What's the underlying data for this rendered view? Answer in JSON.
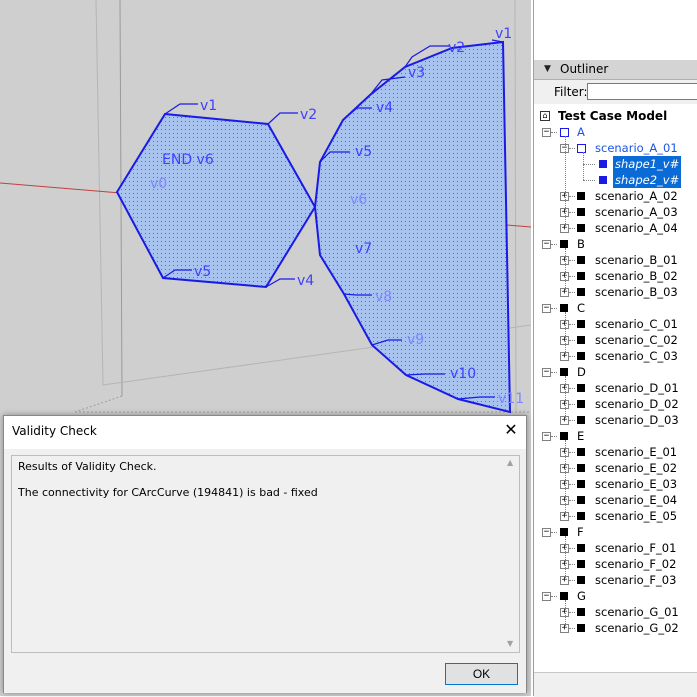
{
  "viewport": {
    "hexagon_labels": {
      "v1": "v1",
      "v2": "v2",
      "v4": "v4",
      "v5": "v5",
      "end_v6": "END v6",
      "v0": "v0"
    },
    "fan_labels": {
      "v1": "v1",
      "v2": "v2",
      "v3": "v3",
      "v4": "v4",
      "v5": "v5",
      "v6": "v6",
      "v7": "v7",
      "v8": "v8",
      "v9": "v9",
      "v10": "v10",
      "v11": "v11"
    },
    "colors": {
      "background": "#cfcfcf",
      "shape_fill": "#a7c1ef",
      "shape_stroke": "#1a1ae6",
      "label": "#4040ff",
      "axis_line": "#c04040"
    }
  },
  "outliner": {
    "title": "Outliner",
    "filter_label": "Filter:",
    "filter_value": "",
    "root": "Test Case Model",
    "tree": [
      {
        "label": "A",
        "expander": "−",
        "children": [
          {
            "label": "scenario_A_01",
            "expander": "−",
            "children": [
              {
                "label": "shape1_v#",
                "selected": true
              },
              {
                "label": "shape2_v#",
                "selected": true
              }
            ]
          },
          {
            "label": "scenario_A_02",
            "expander": "+"
          },
          {
            "label": "scenario_A_03",
            "expander": "+"
          },
          {
            "label": "scenario_A_04",
            "expander": "+"
          }
        ]
      },
      {
        "label": "B",
        "expander": "−",
        "children": [
          {
            "label": "scenario_B_01",
            "expander": "+"
          },
          {
            "label": "scenario_B_02",
            "expander": "+"
          },
          {
            "label": "scenario_B_03",
            "expander": "+"
          }
        ]
      },
      {
        "label": "C",
        "expander": "−",
        "children": [
          {
            "label": "scenario_C_01",
            "expander": "+"
          },
          {
            "label": "scenario_C_02",
            "expander": "+"
          },
          {
            "label": "scenario_C_03",
            "expander": "+"
          }
        ]
      },
      {
        "label": "D",
        "expander": "−",
        "children": [
          {
            "label": "scenario_D_01",
            "expander": "+"
          },
          {
            "label": "scenario_D_02",
            "expander": "+"
          },
          {
            "label": "scenario_D_03",
            "expander": "+"
          }
        ]
      },
      {
        "label": "E",
        "expander": "−",
        "children": [
          {
            "label": "scenario_E_01",
            "expander": "+"
          },
          {
            "label": "scenario_E_02",
            "expander": "+"
          },
          {
            "label": "scenario_E_03",
            "expander": "+"
          },
          {
            "label": "scenario_E_04",
            "expander": "+"
          },
          {
            "label": "scenario_E_05",
            "expander": "+"
          }
        ]
      },
      {
        "label": "F",
        "expander": "−",
        "children": [
          {
            "label": "scenario_F_01",
            "expander": "+"
          },
          {
            "label": "scenario_F_02",
            "expander": "+"
          },
          {
            "label": "scenario_F_03",
            "expander": "+"
          }
        ]
      },
      {
        "label": "G",
        "expander": "−",
        "children": [
          {
            "label": "scenario_G_01",
            "expander": "+"
          },
          {
            "label": "scenario_G_02",
            "expander": "+"
          }
        ]
      }
    ]
  },
  "dialog": {
    "title": "Validity Check",
    "close": "✕",
    "lines": [
      "Results of Validity Check.",
      "The connectivity for CArcCurve (194841) is bad - fixed"
    ],
    "ok_label": "OK"
  }
}
